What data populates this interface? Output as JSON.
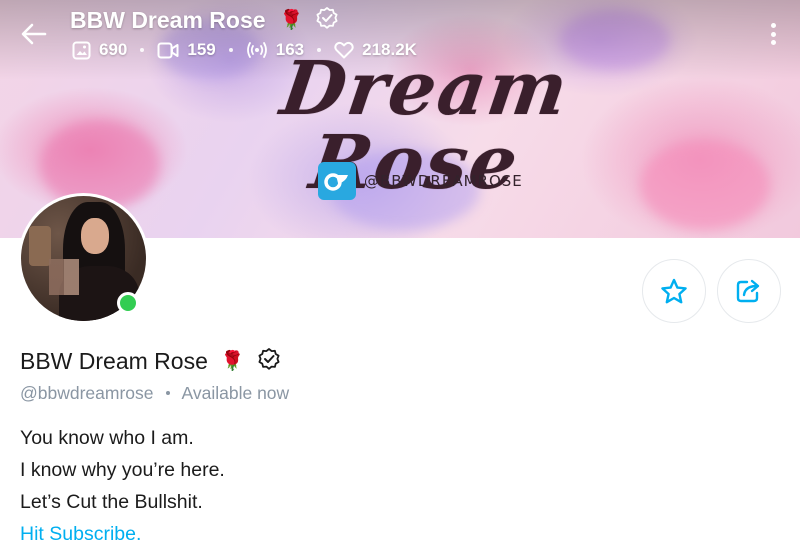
{
  "header": {
    "title": "BBW Dream Rose",
    "title_emoji": "🌹",
    "stats": {
      "photos": "690",
      "videos": "159",
      "streams": "163",
      "likes": "218.2K"
    }
  },
  "cover": {
    "script_text": "Dream Rose",
    "handle_text": "@BBWDREAMROSE"
  },
  "profile": {
    "display_name": "BBW Dream Rose",
    "name_emoji": "🌹",
    "username": "@bbwdreamrose",
    "availability": "Available now",
    "online": true
  },
  "bio": {
    "lines": [
      "You know who I am.",
      "I know why you’re here.",
      "Let’s Cut the Bullshit."
    ],
    "cta": "Hit Subscribe."
  },
  "colors": {
    "accent": "#00aff0",
    "online": "#32cd52",
    "muted": "#8a96a3"
  },
  "icons": {
    "back": "arrow-left-icon",
    "more": "more-vertical-icon",
    "photos": "image-icon",
    "videos": "video-icon",
    "streams": "broadcast-icon",
    "likes": "heart-icon",
    "verified": "verified-badge-icon",
    "favorite": "star-icon",
    "share": "share-icon"
  }
}
